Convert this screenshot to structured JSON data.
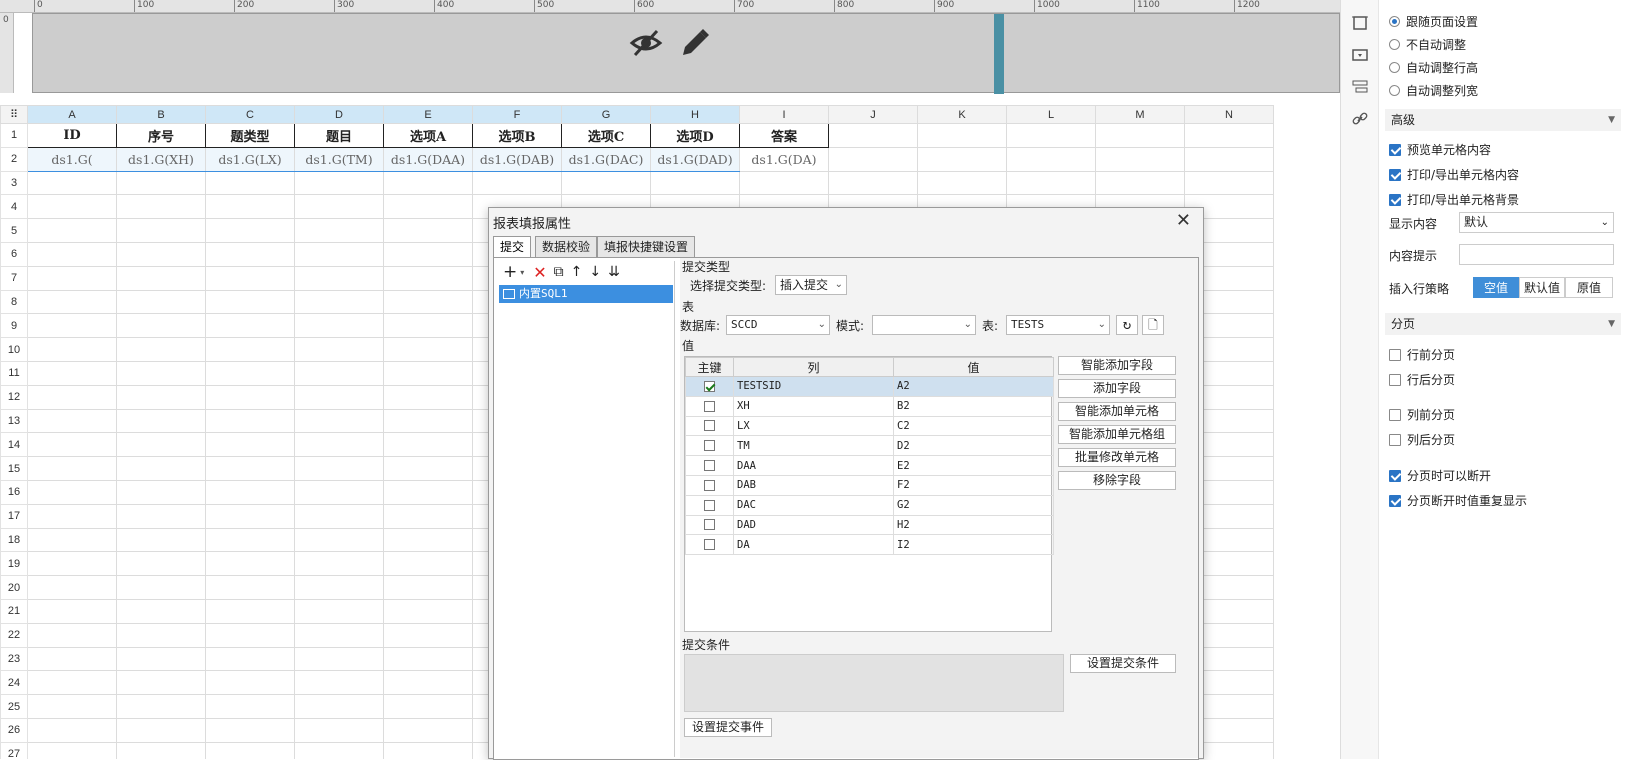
{
  "ruler": {
    "marks": [
      "0",
      "100",
      "200",
      "300",
      "400",
      "500",
      "600",
      "700",
      "800",
      "900",
      "1000",
      "1100",
      "1200"
    ],
    "vmark": "0"
  },
  "grid": {
    "columns": [
      "A",
      "B",
      "C",
      "D",
      "E",
      "F",
      "G",
      "H",
      "I",
      "J",
      "K",
      "L",
      "M",
      "N"
    ],
    "rows": [
      "1",
      "2",
      "3",
      "4",
      "5",
      "6",
      "7",
      "8",
      "9",
      "10",
      "11",
      "12",
      "13",
      "14",
      "15",
      "16",
      "17",
      "18",
      "19",
      "20",
      "21",
      "22",
      "23",
      "24",
      "25",
      "26",
      "27"
    ],
    "row1": [
      "ID",
      "序号",
      "题类型",
      "题目",
      "选项A",
      "选项B",
      "选项C",
      "选项D",
      "答案"
    ],
    "row2": [
      "ds1.G(",
      "ds1.G(XH)",
      "ds1.G(LX)",
      "ds1.G(TM)",
      "ds1.G(DAA)",
      "ds1.G(DAB)",
      "ds1.G(DAC)",
      "ds1.G(DAD)",
      "ds1.G(DA)"
    ]
  },
  "panel": {
    "radios": [
      "跟随页面设置",
      "不自动调整",
      "自动调整行高",
      "自动调整列宽"
    ],
    "advanced_title": "高级",
    "adv_checks": [
      "预览单元格内容",
      "打印/导出单元格内容",
      "打印/导出单元格背景"
    ],
    "display_label": "显示内容",
    "display_value": "默认",
    "tip_label": "内容提示",
    "insert_label": "插入行策略",
    "insert_options": [
      "空值",
      "默认值",
      "原值"
    ],
    "paging_title": "分页",
    "paging_checks": [
      "行前分页",
      "行后分页",
      "列前分页",
      "列后分页",
      "分页时可以断开",
      "分页断开时值重复显示"
    ]
  },
  "dialog": {
    "title": "报表填报属性",
    "close": "✕",
    "tabs": [
      "提交",
      "数据校验",
      "填报快捷键设置"
    ],
    "tree_item": "内置SQL1",
    "submit_type_group": "提交类型",
    "submit_type_label": "选择提交类型:",
    "submit_type_value": "插入提交",
    "table_group": "表",
    "db_label": "数据库:",
    "db_value": "SCCD",
    "schema_label": "模式:",
    "schema_value": "",
    "table_label": "表:",
    "table_value": "TESTS",
    "value_group": "值",
    "headers": [
      "主键",
      "列",
      "值"
    ],
    "rows": [
      {
        "col": "TESTSID",
        "val": "A2",
        "key": true
      },
      {
        "col": "XH",
        "val": "B2",
        "key": false
      },
      {
        "col": "LX",
        "val": "C2",
        "key": false
      },
      {
        "col": "TM",
        "val": "D2",
        "key": false
      },
      {
        "col": "DAA",
        "val": "E2",
        "key": false
      },
      {
        "col": "DAB",
        "val": "F2",
        "key": false
      },
      {
        "col": "DAC",
        "val": "G2",
        "key": false
      },
      {
        "col": "DAD",
        "val": "H2",
        "key": false
      },
      {
        "col": "DA",
        "val": "I2",
        "key": false
      }
    ],
    "side_buttons": [
      "智能添加字段",
      "添加字段",
      "智能添加单元格",
      "智能添加单元格组",
      "批量修改单元格",
      "移除字段"
    ],
    "cond_group": "提交条件",
    "cond_button": "设置提交条件",
    "event_button": "设置提交事件"
  },
  "colors": {
    "accent": "#3c8fe0",
    "selected_header": "#cfe7f7"
  }
}
